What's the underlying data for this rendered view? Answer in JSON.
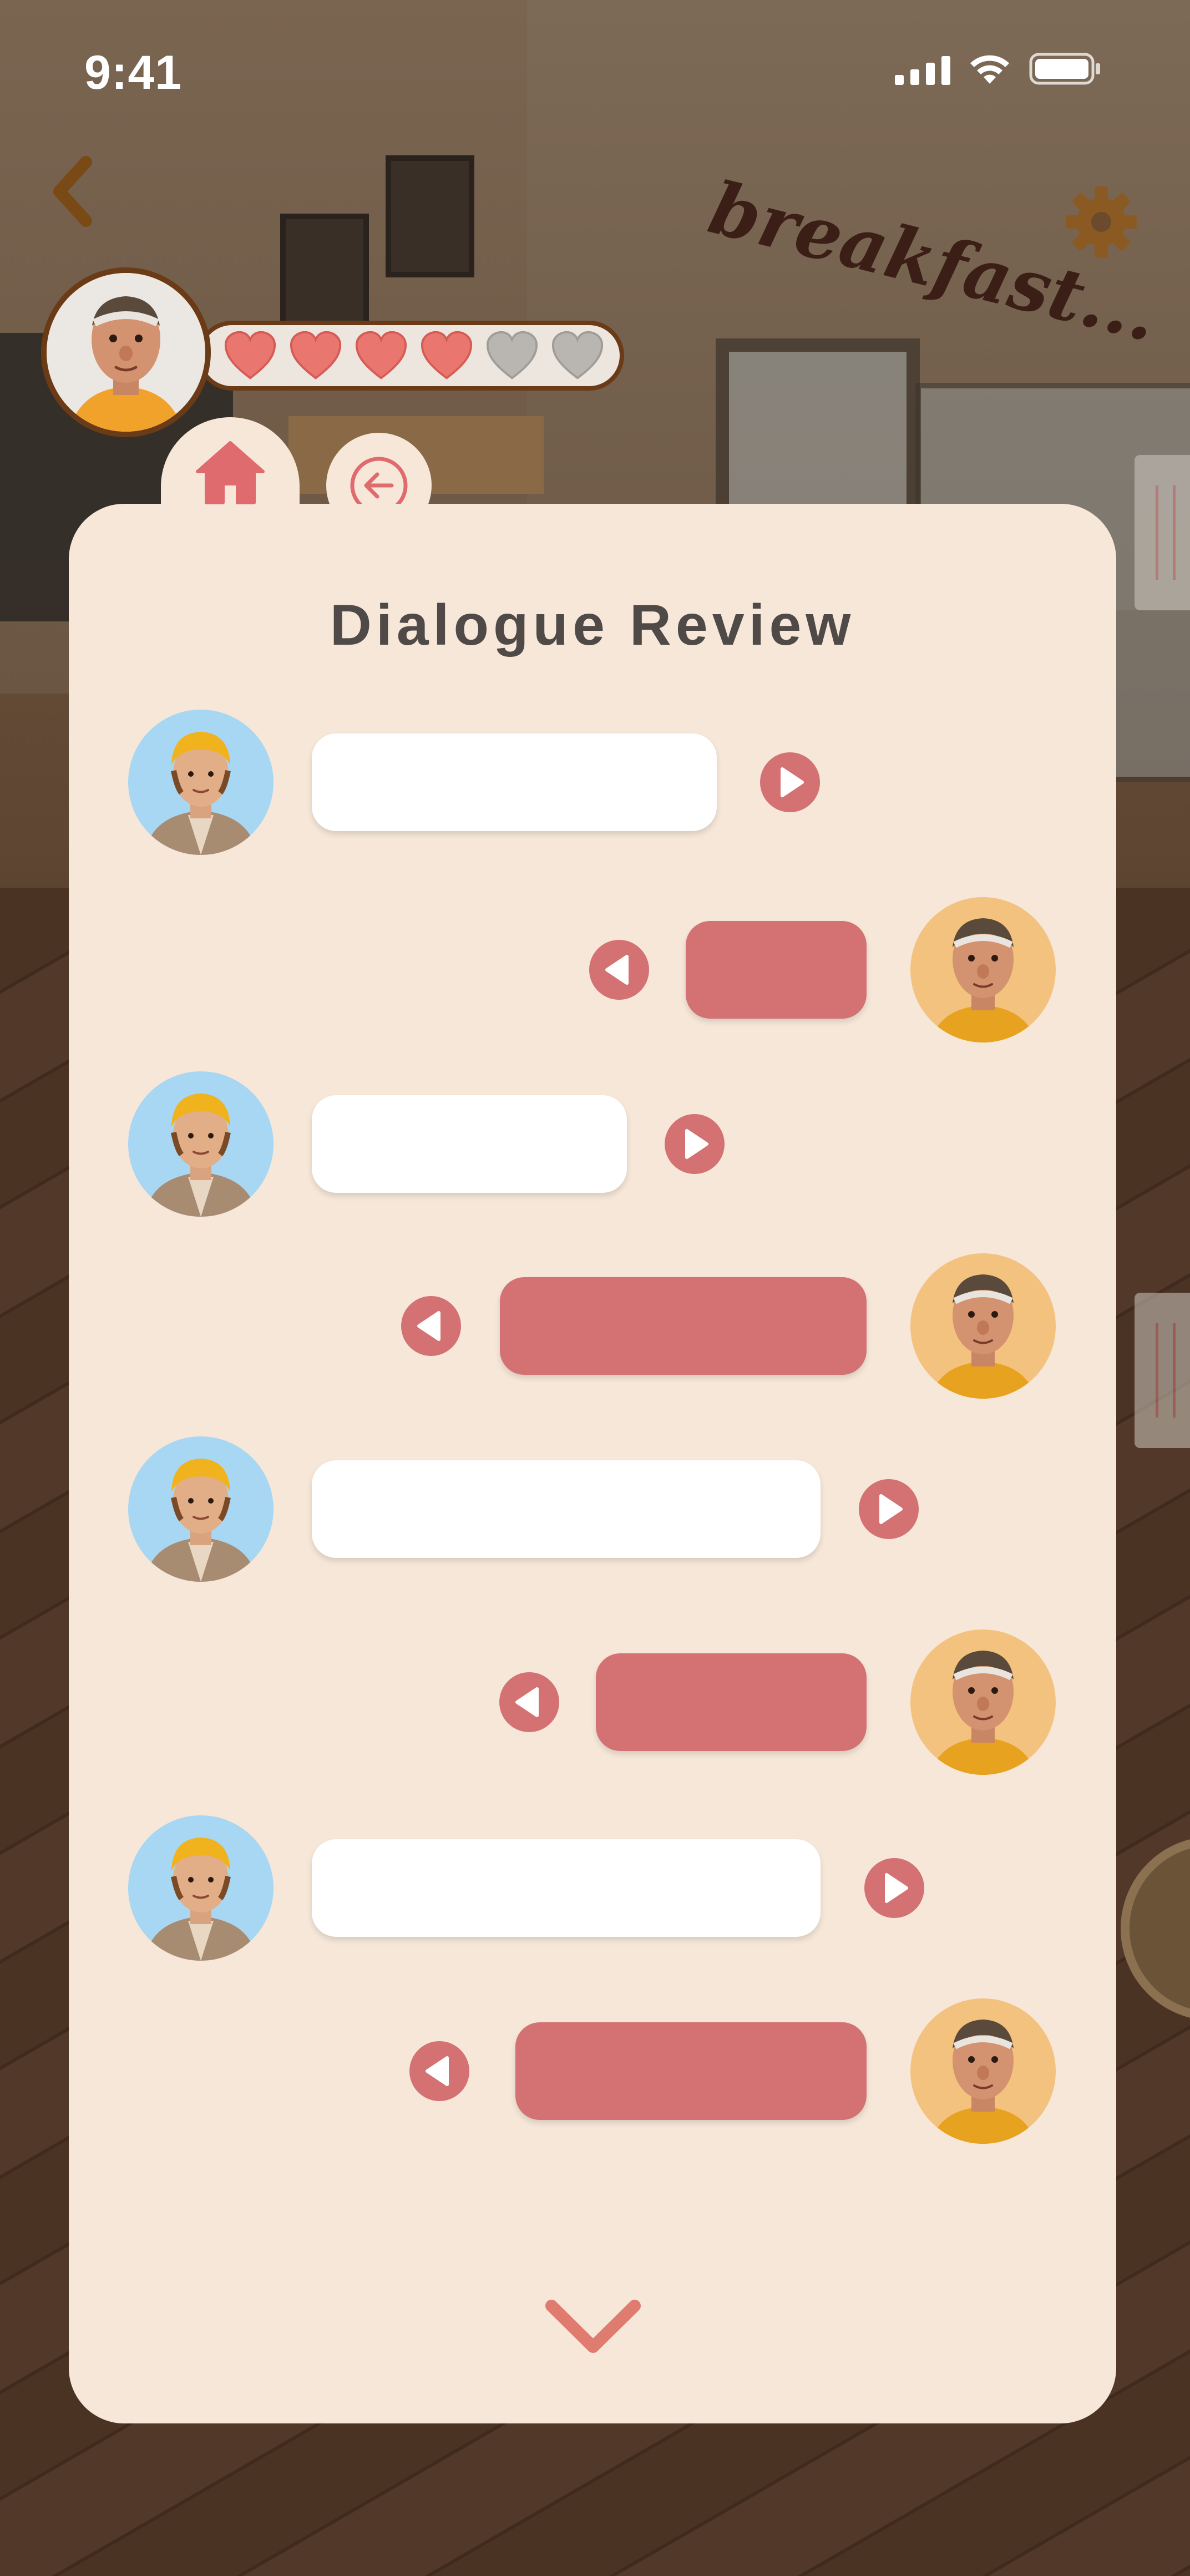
{
  "status_bar": {
    "time": "9:41",
    "icons": [
      "signal-icon",
      "wifi-icon",
      "battery-icon"
    ]
  },
  "header": {
    "back_icon": "chevron-left-icon",
    "settings_icon": "gear-icon",
    "hearts": {
      "filled": 4,
      "total": 6
    }
  },
  "tabs": [
    {
      "icon": "home-icon",
      "active": true
    },
    {
      "icon": "arrow-left-circle-icon",
      "active": false
    }
  ],
  "dialogue": {
    "title": "Dialogue Review",
    "messages": [
      {
        "speaker": "npc",
        "text": ""
      },
      {
        "speaker": "player",
        "text": ""
      },
      {
        "speaker": "npc",
        "text": ""
      },
      {
        "speaker": "player",
        "text": ""
      },
      {
        "speaker": "npc",
        "text": ""
      },
      {
        "speaker": "player",
        "text": ""
      },
      {
        "speaker": "npc",
        "text": ""
      },
      {
        "speaker": "player",
        "text": ""
      }
    ],
    "more_icon": "chevron-down-icon"
  },
  "background": {
    "sign_text": "breakfast..."
  },
  "colors": {
    "panel": "#f6e7d8",
    "accent": "#d47173",
    "title": "#4f4a47",
    "npc_bubble": "#ffffff",
    "player_bubble": "#d47173",
    "heart_filled": "#e9766f",
    "heart_empty": "#b9b5b1"
  }
}
